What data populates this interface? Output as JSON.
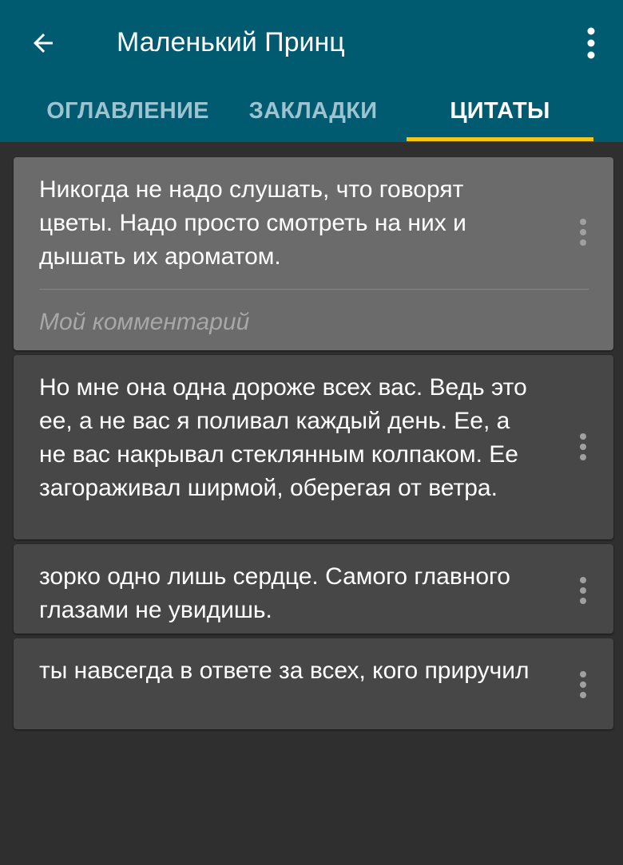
{
  "header": {
    "title": "Маленький Принц"
  },
  "tabs": [
    {
      "label": "ОГЛАВЛЕНИЕ",
      "active": false
    },
    {
      "label": "ЗАКЛАДКИ",
      "active": false
    },
    {
      "label": "ЦИТАТЫ",
      "active": true
    }
  ],
  "quotes": [
    {
      "text": "Никогда не надо слушать, что говорят цветы. Надо просто смотреть на них и дышать их ароматом.",
      "comment": "Мой комментарий",
      "selected": true
    },
    {
      "text": "Но мне она одна дороже всех вас. Ведь это ее, а не вас я поливал каждый день. Ее, а не вас накрывал стеклянным колпаком. Ее загораживал ширмой, оберегая от ветра.",
      "selected": false
    },
    {
      "text": "зорко одно лишь сердце. Самого главного глазами не увидишь.",
      "selected": false
    },
    {
      "text": "ты навсегда в ответе за всех, кого приручил",
      "selected": false
    }
  ],
  "colors": {
    "appbar": "#005a70",
    "tab_indicator": "#f5c518",
    "background": "#2f2f2f",
    "card": "#474747",
    "card_selected": "#6b6b6b"
  },
  "icons": {
    "back": "arrow-left-icon",
    "overflow": "more-vert-icon",
    "card_menu": "more-vert-icon"
  }
}
